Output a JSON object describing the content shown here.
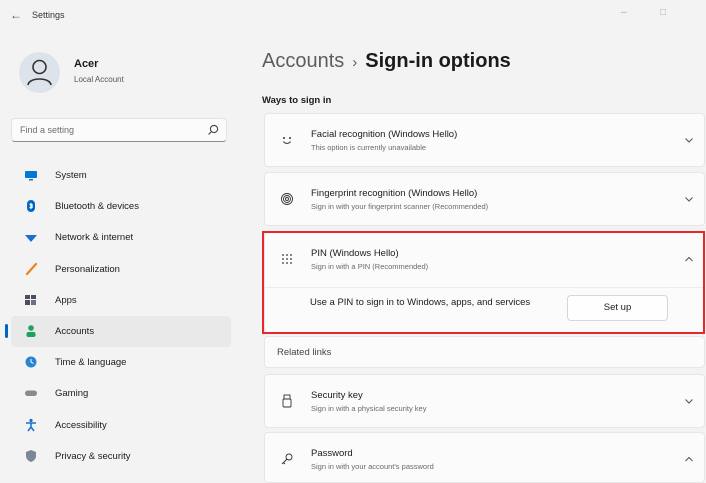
{
  "window": {
    "title": "Settings",
    "back_glyph": "←",
    "minimize_glyph": "–",
    "maximize_glyph": "□",
    "close_glyph": "✕"
  },
  "profile": {
    "name": "Acer",
    "account_type": "Local Account"
  },
  "search": {
    "placeholder": "Find a setting"
  },
  "nav": [
    {
      "label": "System",
      "icon": "monitor-icon",
      "color": "#0078d4"
    },
    {
      "label": "Bluetooth & devices",
      "icon": "bluetooth-icon",
      "color": "#0067c0"
    },
    {
      "label": "Network & internet",
      "icon": "wifi-icon",
      "color": "#1a6fd1"
    },
    {
      "label": "Personalization",
      "icon": "brush-icon",
      "color": "#e8862e"
    },
    {
      "label": "Apps",
      "icon": "apps-icon",
      "color": "#4a4f5a"
    },
    {
      "label": "Accounts",
      "icon": "person-icon",
      "color": "#1aa260",
      "active": true
    },
    {
      "label": "Time & language",
      "icon": "globe-clock-icon",
      "color": "#2a84d2"
    },
    {
      "label": "Gaming",
      "icon": "controller-icon",
      "color": "#8a8a8a"
    },
    {
      "label": "Accessibility",
      "icon": "accessibility-icon",
      "color": "#1a6fd1"
    },
    {
      "label": "Privacy & security",
      "icon": "shield-icon",
      "color": "#7b8794"
    }
  ],
  "header": {
    "crumb": "Accounts",
    "separator": "›",
    "current": "Sign-in options"
  },
  "section_title": "Ways to sign in",
  "options": [
    {
      "title": "Facial recognition (Windows Hello)",
      "subtitle": "This option is currently unavailable",
      "icon": "face-icon",
      "expanded": false
    },
    {
      "title": "Fingerprint recognition (Windows Hello)",
      "subtitle": "Sign in with your fingerprint scanner (Recommended)",
      "icon": "fingerprint-icon",
      "expanded": false
    },
    {
      "title": "PIN (Windows Hello)",
      "subtitle": "Sign in with a PIN (Recommended)",
      "icon": "pin-keypad-icon",
      "expanded": true,
      "body": "Use a PIN to sign in to Windows, apps, and services",
      "button": "Set up"
    },
    {
      "title": "Security key",
      "subtitle": "Sign in with a physical security key",
      "icon": "usb-key-icon",
      "expanded": false
    },
    {
      "title": "Password",
      "subtitle": "Sign in with your account's password",
      "icon": "key-icon",
      "expanded": true
    }
  ],
  "related_links": "Related links",
  "colors": {
    "accent": "#0067c0",
    "highlight": "#e8262b",
    "background": "#f3f3f3",
    "card": "#fbfbfb"
  }
}
